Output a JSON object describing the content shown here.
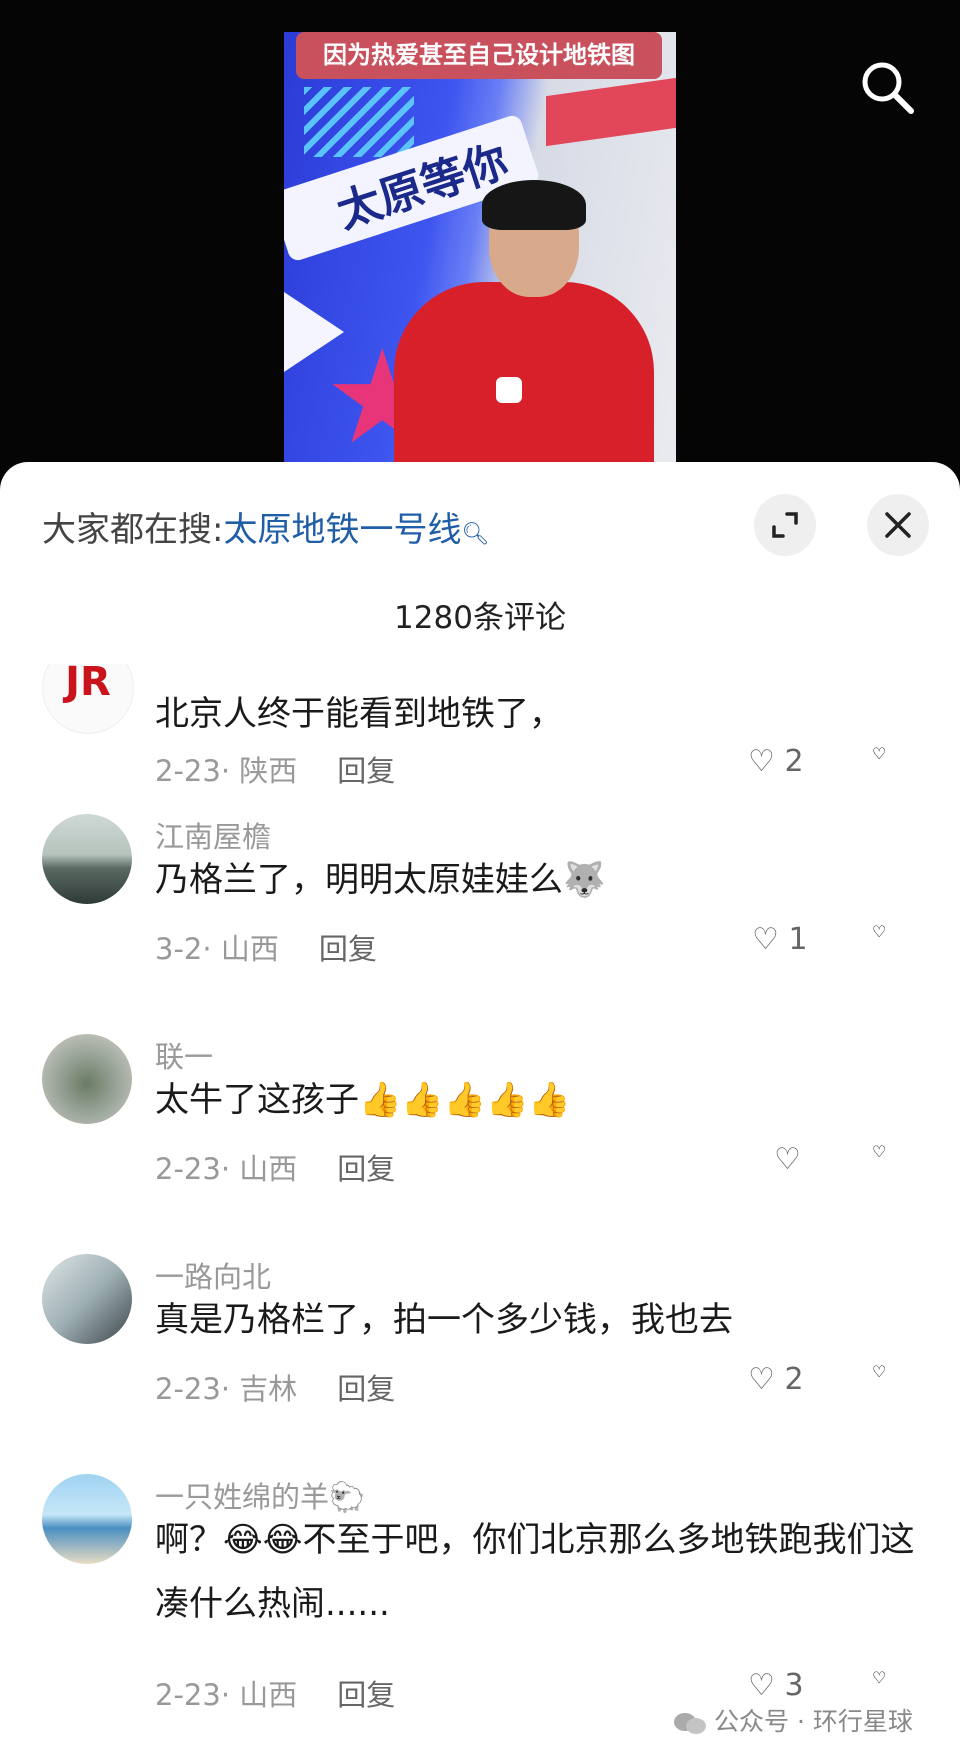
{
  "video": {
    "caption": "因为热爱甚至自己设计地铁图",
    "sign_text": "太原等你"
  },
  "search_bar": {
    "label": "大家都在搜:",
    "keyword": "太原地铁一号线"
  },
  "comment_count": "1280条评论",
  "comments": [
    {
      "username": "",
      "text": "北京人终于能看到地铁了，",
      "date": "2-23",
      "location": "陕西",
      "reply": "回复",
      "likes": "2",
      "avatar": "red-logo"
    },
    {
      "username": "江南屋檐",
      "text": "乃格兰了，明明太原娃娃么",
      "emoji": "🐺",
      "date": "3-2",
      "location": "山西",
      "reply": "回复",
      "likes": "1",
      "avatar": "landscape"
    },
    {
      "username": "联一",
      "text": "太牛了这孩子",
      "emoji": "👍👍👍👍👍",
      "date": "2-23",
      "location": "山西",
      "reply": "回复",
      "likes": "",
      "avatar": "flowers"
    },
    {
      "username": "一路向北",
      "text": "真是乃格栏了，拍一个多少钱，我也去",
      "date": "2-23",
      "location": "吉林",
      "reply": "回复",
      "likes": "2",
      "avatar": "person"
    },
    {
      "username": "一只姓绵的羊",
      "username_emoji": "🐑",
      "text": "啊？😂😂不至于吧，你们北京那么多地铁跑我们这凑什么热闹......",
      "date": "2-23",
      "location": "山西",
      "reply": "回复",
      "likes": "3",
      "avatar": "beach"
    }
  ],
  "watermark": "公众号 · 环行星球",
  "colors": {
    "keyword": "#215ea8",
    "jacket": "#d8202a",
    "caption_bg": "#c8515d"
  }
}
